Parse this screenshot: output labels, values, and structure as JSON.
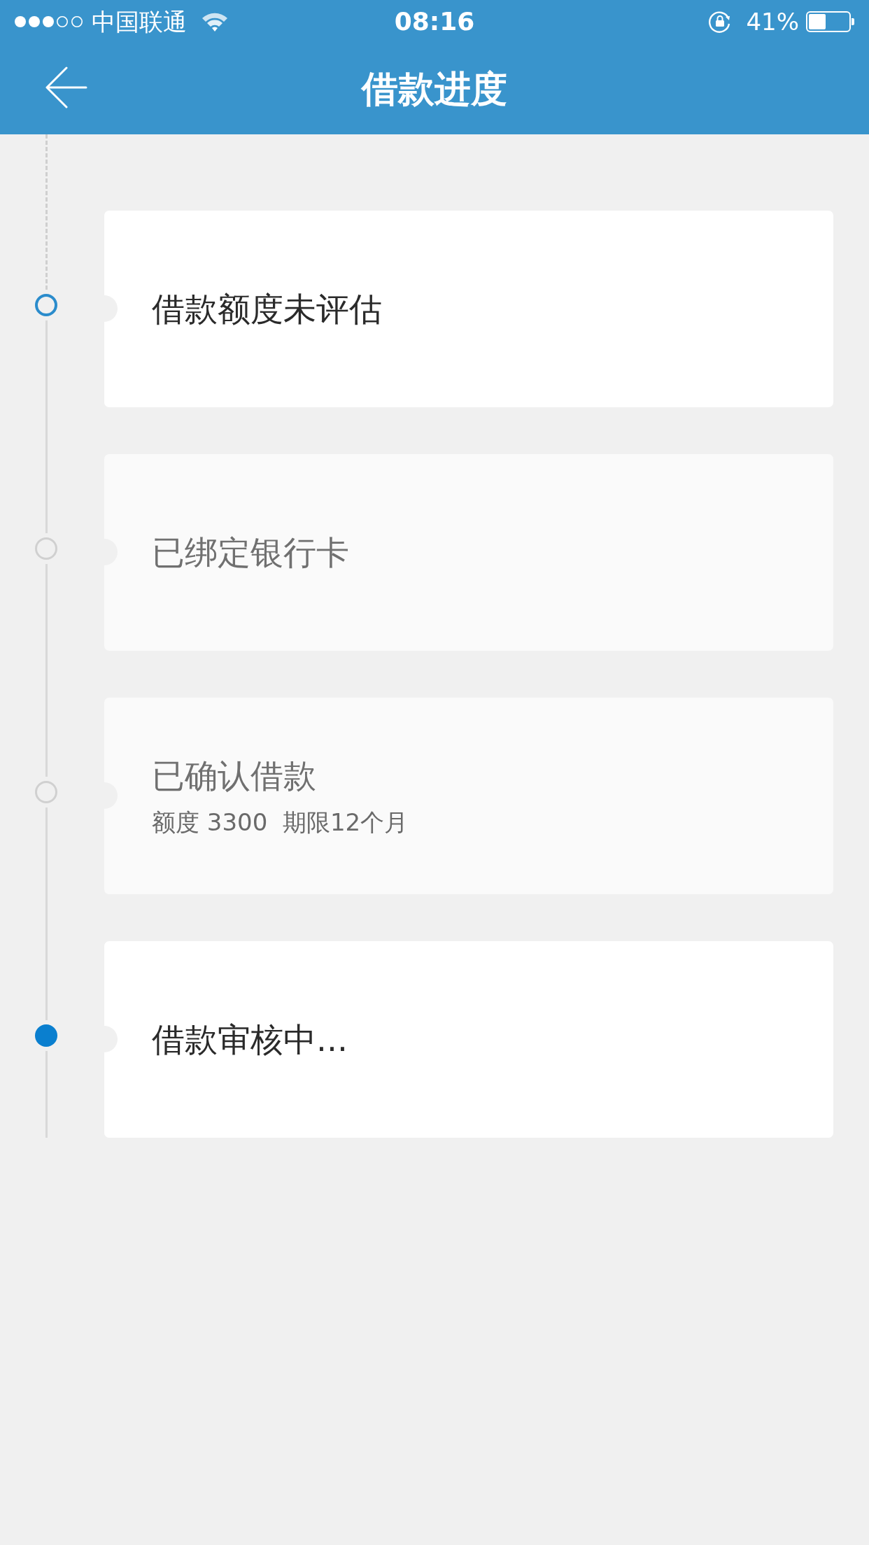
{
  "status_bar": {
    "carrier": "中国联通",
    "time": "08:16",
    "battery_percent": "41%"
  },
  "nav_bar": {
    "title": "借款进度"
  },
  "steps": [
    {
      "title": "借款额度未评估",
      "active": true,
      "filled": false
    },
    {
      "title": "已绑定银行卡",
      "active": false,
      "filled": false
    },
    {
      "title": "已确认借款",
      "detail": "额度 3300  期限12个月",
      "active": false,
      "filled": false
    },
    {
      "title": "借款审核中...",
      "active": true,
      "filled": true
    }
  ]
}
